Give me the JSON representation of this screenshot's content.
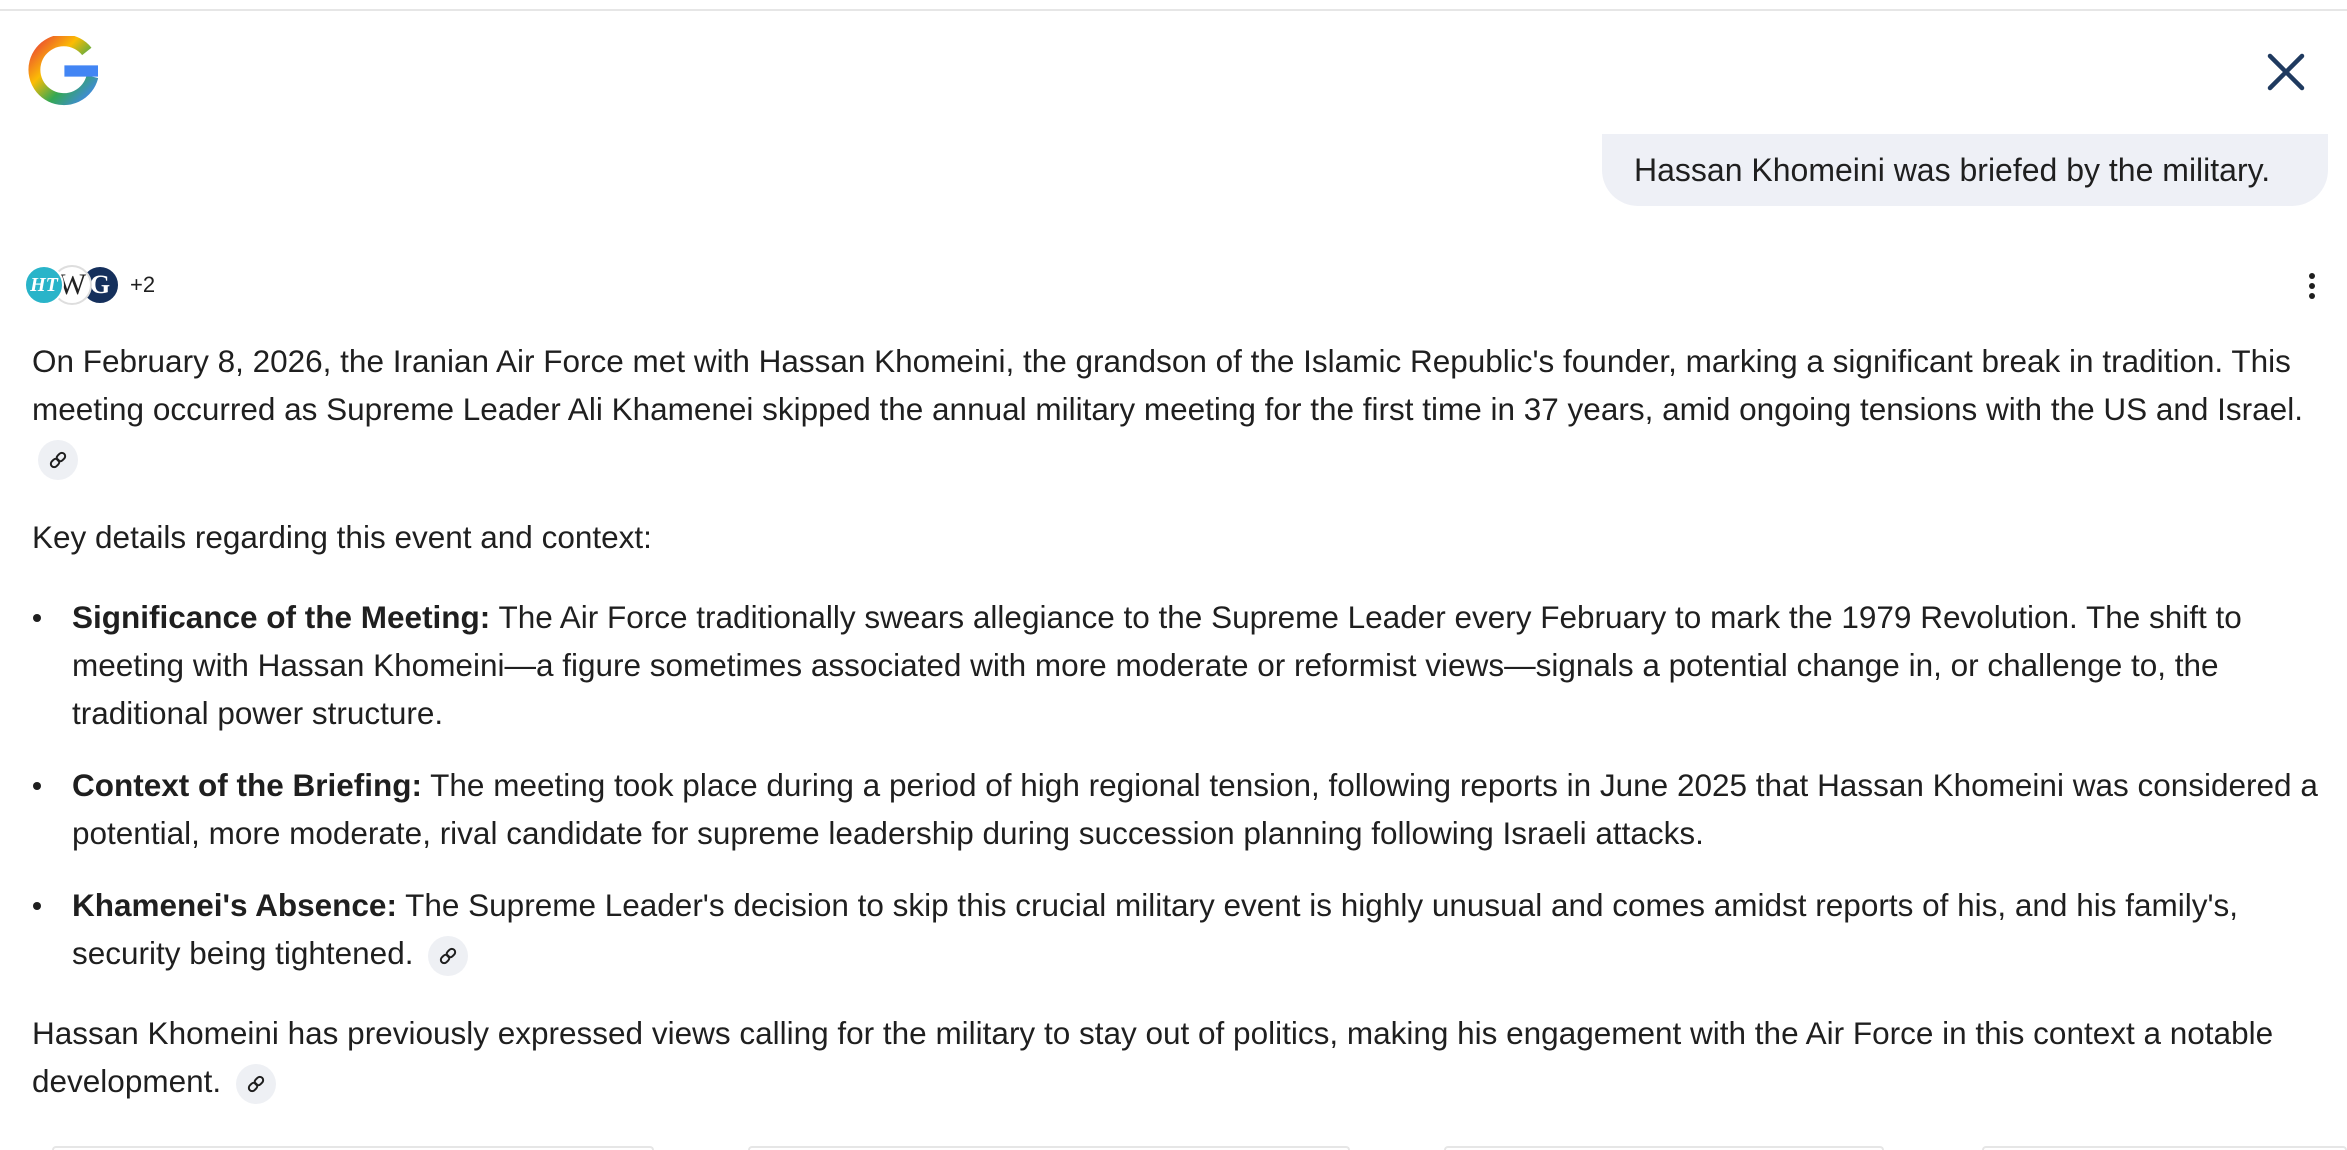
{
  "user_query": "Hassan Khomeini was briefed by the military.",
  "sources": {
    "badges": [
      {
        "label": "HT",
        "name": "hindustan-times"
      },
      {
        "label": "W",
        "name": "wikipedia"
      },
      {
        "label": "G",
        "name": "source-g"
      }
    ],
    "more_count": "+2"
  },
  "answer": {
    "intro": "On February 8, 2026, the Iranian Air Force met with Hassan Khomeini, the grandson of the Islamic Republic's founder, marking a significant break in tradition. This meeting occurred as Supreme Leader Ali Khamenei skipped the annual military meeting for the first time in 37 years, amid ongoing tensions with the US and Israel.",
    "lead": "Key details regarding this event and context:",
    "items": [
      {
        "title": "Significance of the Meeting:",
        "text": "The Air Force traditionally swears allegiance to the Supreme Leader every February to mark the 1979 Revolution. The shift to meeting with Hassan Khomeini—a figure sometimes associated with more moderate or reformist views—signals a potential change in, or challenge to, the traditional power structure."
      },
      {
        "title": "Context of the Briefing:",
        "text": "The meeting took place during a period of high regional tension, following reports in June 2025 that Hassan Khomeini was considered a potential, more moderate, rival candidate for supreme leadership during succession planning following Israeli attacks."
      },
      {
        "title": "Khamenei's Absence:",
        "text": "The Supreme Leader's decision to skip this crucial military event is highly unusual and comes amidst reports of his, and his family's, security being tightened."
      }
    ],
    "closing": "Hassan Khomeini has previously expressed views calling for the military to stay out of politics, making his engagement with the Air Force in this context a notable development."
  },
  "icons": {
    "logo": "google-g-logo",
    "close": "close-icon",
    "more": "more-vert-icon",
    "citation": "link-icon"
  },
  "colors": {
    "bubble_bg": "#eef0f6",
    "text": "#1f1f1f",
    "citation_bg": "#eef0f4"
  }
}
